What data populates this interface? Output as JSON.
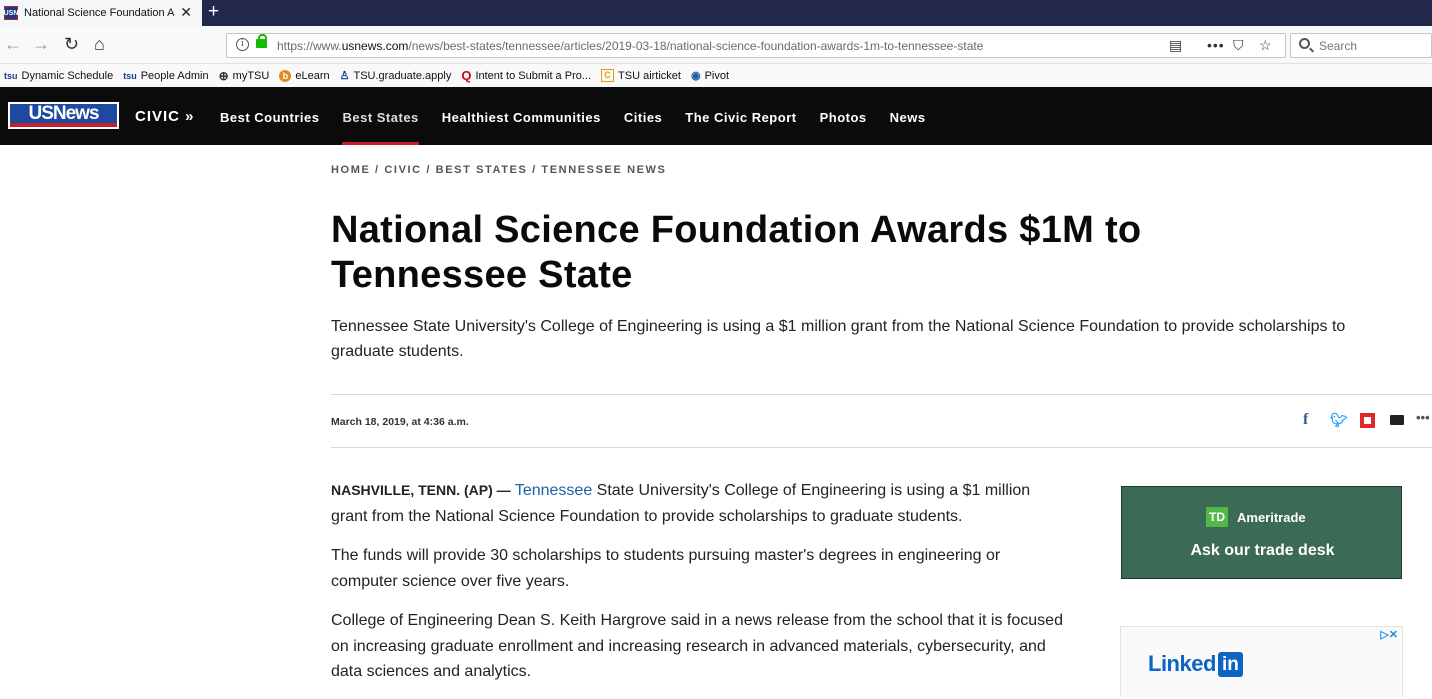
{
  "browser": {
    "tab_title": "National Science Foundation A",
    "tab_favicon_text": "USN",
    "url_prefix": "https://www.",
    "url_domain": "usnews.com",
    "url_path": "/news/best-states/tennessee/articles/2019-03-18/national-science-foundation-awards-1m-to-tennessee-state",
    "search_placeholder": "Search",
    "bookmarks": [
      {
        "icon": "tsu",
        "label": "Dynamic Schedule"
      },
      {
        "icon": "tsu",
        "label": "People Admin"
      },
      {
        "icon": "globe",
        "label": "myTSU"
      },
      {
        "icon": "b",
        "label": "eLearn"
      },
      {
        "icon": "figure",
        "label": "TSU.graduate.apply"
      },
      {
        "icon": "q",
        "label": "Intent to Submit a Pro..."
      },
      {
        "icon": "c",
        "label": "TSU airticket"
      },
      {
        "icon": "pivot",
        "label": "Pivot"
      }
    ]
  },
  "site": {
    "logo_text": "USNews",
    "section": "CIVIC »",
    "nav": [
      {
        "label": "Best Countries",
        "active": false
      },
      {
        "label": "Best States",
        "active": true
      },
      {
        "label": "Healthiest Communities",
        "active": false
      },
      {
        "label": "Cities",
        "active": false
      },
      {
        "label": "The Civic Report",
        "active": false
      },
      {
        "label": "Photos",
        "active": false
      },
      {
        "label": "News",
        "active": false
      }
    ]
  },
  "article": {
    "breadcrumb": "HOME / CIVIC / BEST STATES / TENNESSEE NEWS",
    "headline": "National Science Foundation Awards $1M to Tennessee State",
    "dek": "Tennessee State University's College of Engineering is using a $1 million grant from the National Science Foundation to provide scholarships to graduate students.",
    "date": "March 18, 2019, at 4:36 a.m.",
    "dateline": "NASHVILLE, TENN. (AP) —",
    "p1_link": "Tennessee",
    "p1_rest": " State University's College of Engineering is using a $1 million grant from the National Science Foundation to provide scholarships to graduate students.",
    "p2": "The funds will provide 30 scholarships to students pursuing master's degrees in engineering or computer science over five years.",
    "p3": "College of Engineering Dean S. Keith Hargrove said in a news release from the school that it is focused on increasing graduate enrollment and increasing research in advanced materials, cybersecurity, and data sciences and analytics."
  },
  "ads": {
    "td_badge": "TD",
    "td_name": "Ameritrade",
    "td_text": "Ask our trade desk",
    "linkedin_text": "Linked",
    "linkedin_in": "in",
    "adchoices": "▷✕"
  },
  "colors": {
    "header_bg": "#0b0b0b",
    "accent_red": "#c41e2b",
    "link_blue": "#1f5fa6",
    "td_green": "#3b6b55"
  }
}
